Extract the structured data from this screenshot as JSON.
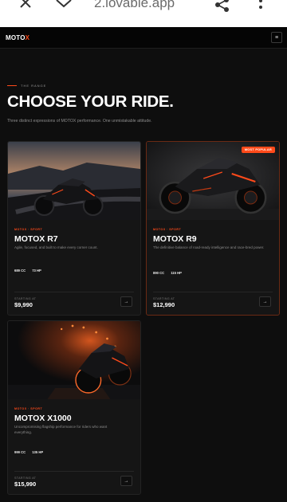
{
  "browser": {
    "url": "2.lovable.app",
    "icons": [
      "close-icon",
      "chevron-down-icon",
      "share-icon",
      "more-vertical-icon"
    ]
  },
  "nav": {
    "logo_main": "MOTO",
    "logo_accent": "X",
    "menu_icon": "≡"
  },
  "hero": {
    "eyebrow": "THE RANGE",
    "title": "CHOOSE YOUR RIDE.",
    "subtitle": "Three distinct expressions of MOTOX performance. One unmistakable attitude."
  },
  "cards": [
    {
      "category": "MOTOX · SPORT",
      "name": "MOTOX R7",
      "description": "Agile, focused, and built to make every corner count.",
      "spec_cc": "689 CC",
      "spec_hp": "73 HP",
      "starting_label": "STARTING AT",
      "price": "$9,990",
      "arrow": "→"
    },
    {
      "badge": "MOST POPULAR",
      "category": "MOTOX · SPORT",
      "name": "MOTOX R9",
      "description": "The definitive balance of road-ready intelligence and race-bred power.",
      "spec_cc": "890 CC",
      "spec_hp": "115 HP",
      "starting_label": "STARTING AT",
      "price": "$12,990",
      "arrow": "→"
    },
    {
      "category": "MOTOX · SPORT",
      "name": "MOTOX X1000",
      "description": "Uncompromising flagship performance for riders who want everything.",
      "spec_cc": "999 CC",
      "spec_hp": "135 HP",
      "starting_label": "STARTING AT",
      "price": "$15,990",
      "arrow": "→"
    }
  ],
  "colors": {
    "accent": "#ff4a1a",
    "background": "#0e0e0e",
    "card": "#151515"
  }
}
